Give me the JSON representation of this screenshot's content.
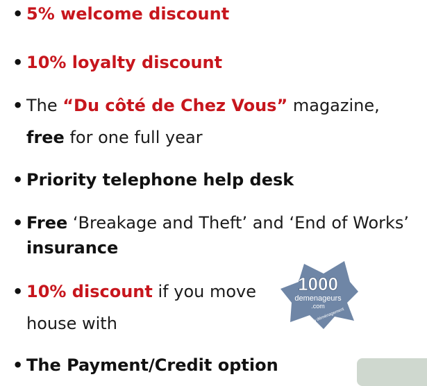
{
  "items": [
    {
      "bullet": "•",
      "red_text": "5% welcome discount"
    },
    {
      "bullet": "•",
      "red_text": "10% loyalty discount"
    },
    {
      "bullet": "•",
      "pre": "The ",
      "red_text": "“Du côté de Chez Vous”",
      "post": " magazine,",
      "line2_bold": "free",
      "line2_rest": " for one full year"
    },
    {
      "bullet": "•",
      "bold_text": "Priority telephone help desk"
    },
    {
      "bullet": "•",
      "bold_text": "Free",
      "rest": " ‘Breakage and Theft’ and ‘End of Works’",
      "line2_bold": "insurance"
    },
    {
      "bullet": "•",
      "red_text": "10% discount",
      "rest": " if you move",
      "line2": "house with"
    },
    {
      "bullet": "•",
      "bold_text": "The Payment/Credit option"
    }
  ],
  "logo": {
    "number": "1000",
    "brand": "demenageurs",
    "domain": ".com",
    "tagline": "les pros du déménagement"
  },
  "colors": {
    "accent_red": "#c7161d",
    "logo_blue": "#6f86a6",
    "corner_box": "#cfd8cf"
  }
}
